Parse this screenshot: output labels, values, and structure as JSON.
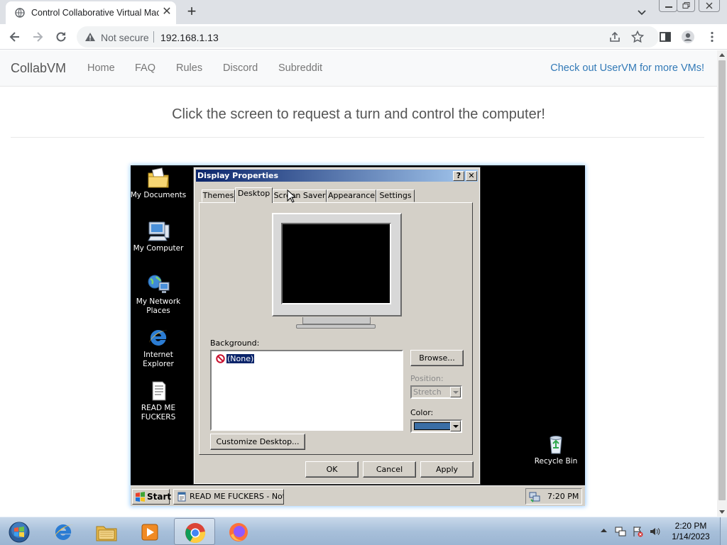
{
  "browser": {
    "tab_title": "Control Collaborative Virtual Machines",
    "security_label": "Not secure",
    "url": "192.168.1.13"
  },
  "site": {
    "brand": "CollabVM",
    "nav": [
      "Home",
      "FAQ",
      "Rules",
      "Discord",
      "Subreddit"
    ],
    "promo_link": "Check out UserVM for more VMs!",
    "prompt": "Click the screen to request a turn and control the computer!"
  },
  "vm": {
    "desktop_icons": [
      {
        "label": "My Documents",
        "icon": "folder-documents-icon"
      },
      {
        "label": "My Computer",
        "icon": "my-computer-icon"
      },
      {
        "label": "My Network Places",
        "icon": "network-places-icon"
      },
      {
        "label": "Internet Explorer",
        "icon": "internet-explorer-icon"
      },
      {
        "label": "READ ME FUCKERS",
        "icon": "text-document-icon"
      }
    ],
    "recycle_bin": "Recycle Bin",
    "dialog": {
      "title": "Display Properties",
      "help_button": "?",
      "close_button": "✕",
      "tabs": [
        "Themes",
        "Desktop",
        "Screen Saver",
        "Appearance",
        "Settings"
      ],
      "active_tab": "Desktop",
      "background_label": "Background:",
      "background_items": [
        "(None)"
      ],
      "browse_button": "Browse...",
      "position_label": "Position:",
      "position_value": "Stretch",
      "color_label": "Color:",
      "color_value": "#3a6ea5",
      "customize_button": "Customize Desktop...",
      "ok_button": "OK",
      "cancel_button": "Cancel",
      "apply_button": "Apply"
    },
    "taskbar": {
      "start_label": "Start",
      "task_label": "READ ME FUCKERS - Not...",
      "clock": "7:20 PM"
    }
  },
  "host_taskbar": {
    "time": "2:20 PM",
    "date": "1/14/2023",
    "pinned": [
      "windows-start-orb-icon",
      "internet-explorer-icon",
      "file-explorer-icon",
      "media-player-icon",
      "chrome-icon",
      "firefox-icon"
    ],
    "active_app": "chrome-icon"
  }
}
